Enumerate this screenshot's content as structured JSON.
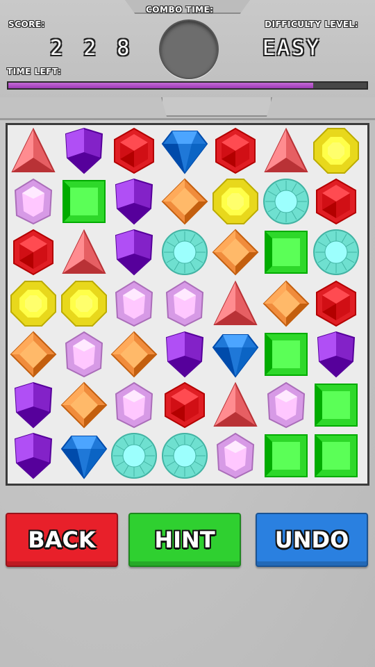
{
  "hud": {
    "score_label": "SCORE:",
    "score_value": "2 2 8",
    "combo_label": "COMBO TIME:",
    "difficulty_label": "DIFFICULTY LEVEL:",
    "difficulty_value": "EASY",
    "time_left_label": "TIME LEFT:",
    "time_left_fraction": 0.85,
    "time_bar_color": "#b050c8"
  },
  "board": {
    "rows": 7,
    "cols": 7,
    "grid": [
      [
        "red-triangle",
        "purple-shield",
        "red-hexagon",
        "blue-diamond",
        "red-hexagon",
        "red-triangle",
        "yellow-octagon"
      ],
      [
        "pink-pentagon",
        "green-square",
        "purple-shield",
        "orange-rhombus",
        "yellow-octagon",
        "teal-round",
        "red-hexagon"
      ],
      [
        "red-hexagon",
        "red-triangle",
        "purple-shield",
        "teal-round",
        "orange-rhombus",
        "green-square",
        "teal-round"
      ],
      [
        "yellow-octagon",
        "yellow-octagon",
        "pink-pentagon",
        "pink-pentagon",
        "red-triangle",
        "orange-rhombus",
        "red-hexagon"
      ],
      [
        "orange-rhombus",
        "pink-pentagon",
        "orange-rhombus",
        "purple-shield",
        "blue-diamond",
        "green-square",
        "purple-shield"
      ],
      [
        "purple-shield",
        "orange-rhombus",
        "pink-pentagon",
        "red-hexagon",
        "red-triangle",
        "pink-pentagon",
        "green-square"
      ],
      [
        "purple-shield",
        "blue-diamond",
        "teal-round",
        "teal-round",
        "pink-pentagon",
        "green-square",
        "green-square"
      ]
    ]
  },
  "colors": {
    "red": "#e01e24",
    "purple": "#8322c8",
    "blue": "#1f78d8",
    "yellow": "#e8d81c",
    "green": "#2ed82a",
    "orange": "#f08c3c",
    "pink": "#d79ae6",
    "teal": "#6fe0d0",
    "triangle": "#e65f63"
  },
  "buttons": {
    "back_label": "BACK",
    "back_color": "#e8202a",
    "hint_label": "HINT",
    "hint_color": "#2fd030",
    "undo_label": "UNDO",
    "undo_color": "#2a80e0"
  }
}
